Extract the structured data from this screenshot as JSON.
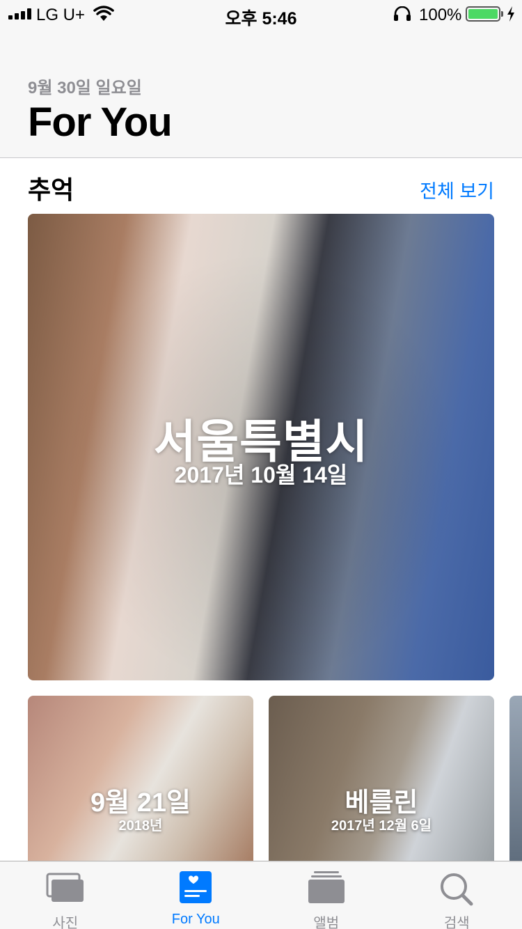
{
  "status_bar": {
    "carrier": "LG U+",
    "time": "오후 5:46",
    "battery_percent": "100%",
    "battery_color": "#4cd964"
  },
  "header": {
    "date": "9월 30일 일요일",
    "title": "For You"
  },
  "memories": {
    "section_title": "추억",
    "see_all": "전체 보기",
    "featured": {
      "title": "서울특별시",
      "subtitle": "2017년 10월 14일"
    },
    "cards": [
      {
        "title": "9월 21일",
        "subtitle": "2018년"
      },
      {
        "title": "베를린",
        "subtitle": "2017년 12월 6일"
      }
    ]
  },
  "tab_bar": {
    "active_color": "#007aff",
    "inactive_color": "#8e8e93",
    "tabs": [
      {
        "label": "사진",
        "icon": "photos-icon"
      },
      {
        "label": "For You",
        "icon": "for-you-icon"
      },
      {
        "label": "앨범",
        "icon": "albums-icon"
      },
      {
        "label": "검색",
        "icon": "search-icon"
      }
    ]
  }
}
